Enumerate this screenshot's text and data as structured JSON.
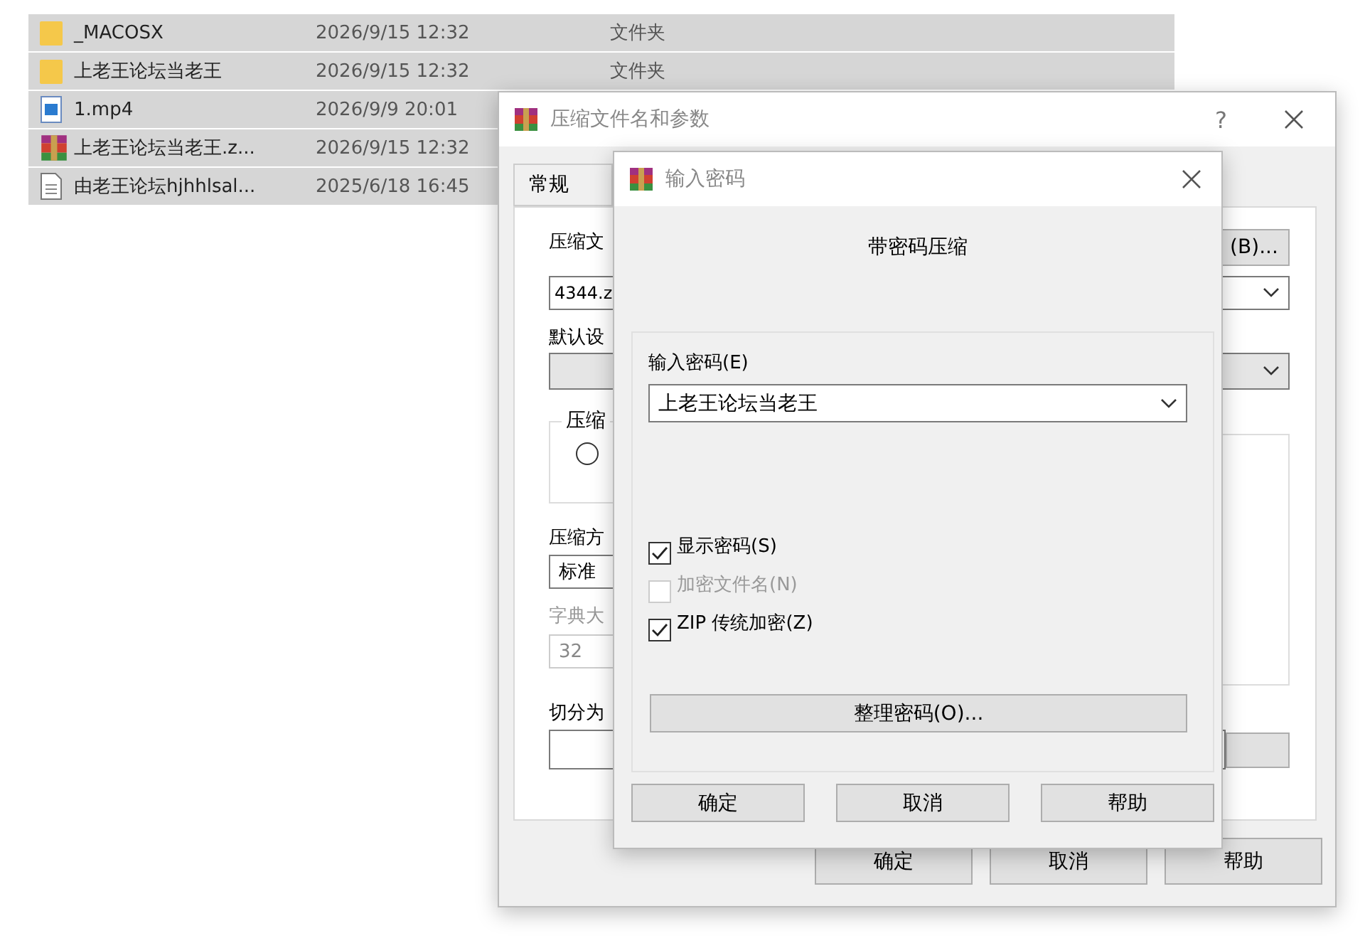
{
  "file_list": {
    "rows": [
      {
        "kind": "folder",
        "name": "_MACOSX",
        "modified": "2026/9/15 12:32",
        "type": "文件夹"
      },
      {
        "kind": "folder",
        "name": "上老王论坛当老王",
        "modified": "2026/9/15 12:32",
        "type": "文件夹"
      },
      {
        "kind": "video",
        "name": "1.mp4",
        "modified": "2026/9/9 20:01"
      },
      {
        "kind": "archive",
        "name": "上老王论坛当老王.z...",
        "modified": "2026/9/15 12:32"
      },
      {
        "kind": "text",
        "name": "由老王论坛hjhhlsal...",
        "modified": "2025/6/18 16:45"
      }
    ]
  },
  "archive_window": {
    "title": "压缩文件名和参数",
    "help": "?",
    "tabs": [
      {
        "label": "常规",
        "selected": false
      }
    ],
    "archive_name_label": "压缩文",
    "archive_name": "4344.z",
    "browse_button": "(B)...",
    "profile_label": "默认设",
    "format_group_label": "压缩",
    "format_radio_selected": false,
    "method_label": "压缩方",
    "method": "标准",
    "dictionary_label": "字典大",
    "dictionary_disabled": true,
    "dictionary": "32",
    "split_label": "切分为",
    "buttons": [
      "确定",
      "取消",
      "帮助"
    ]
  },
  "password_dialog": {
    "title": "输入密码",
    "heading": "带密码压缩",
    "password_label": "输入密码(E)",
    "password": "上老王论坛当老王",
    "options": [
      {
        "label": "显示密码(S)",
        "checked": true,
        "disabled": false
      },
      {
        "label": "加密文件名(N)",
        "checked": false,
        "disabled": true
      },
      {
        "label": "ZIP 传统加密(Z)",
        "checked": true,
        "disabled": false
      }
    ],
    "organize_button": "整理密码(O)...",
    "buttons": [
      "确定",
      "取消",
      "帮助"
    ]
  }
}
